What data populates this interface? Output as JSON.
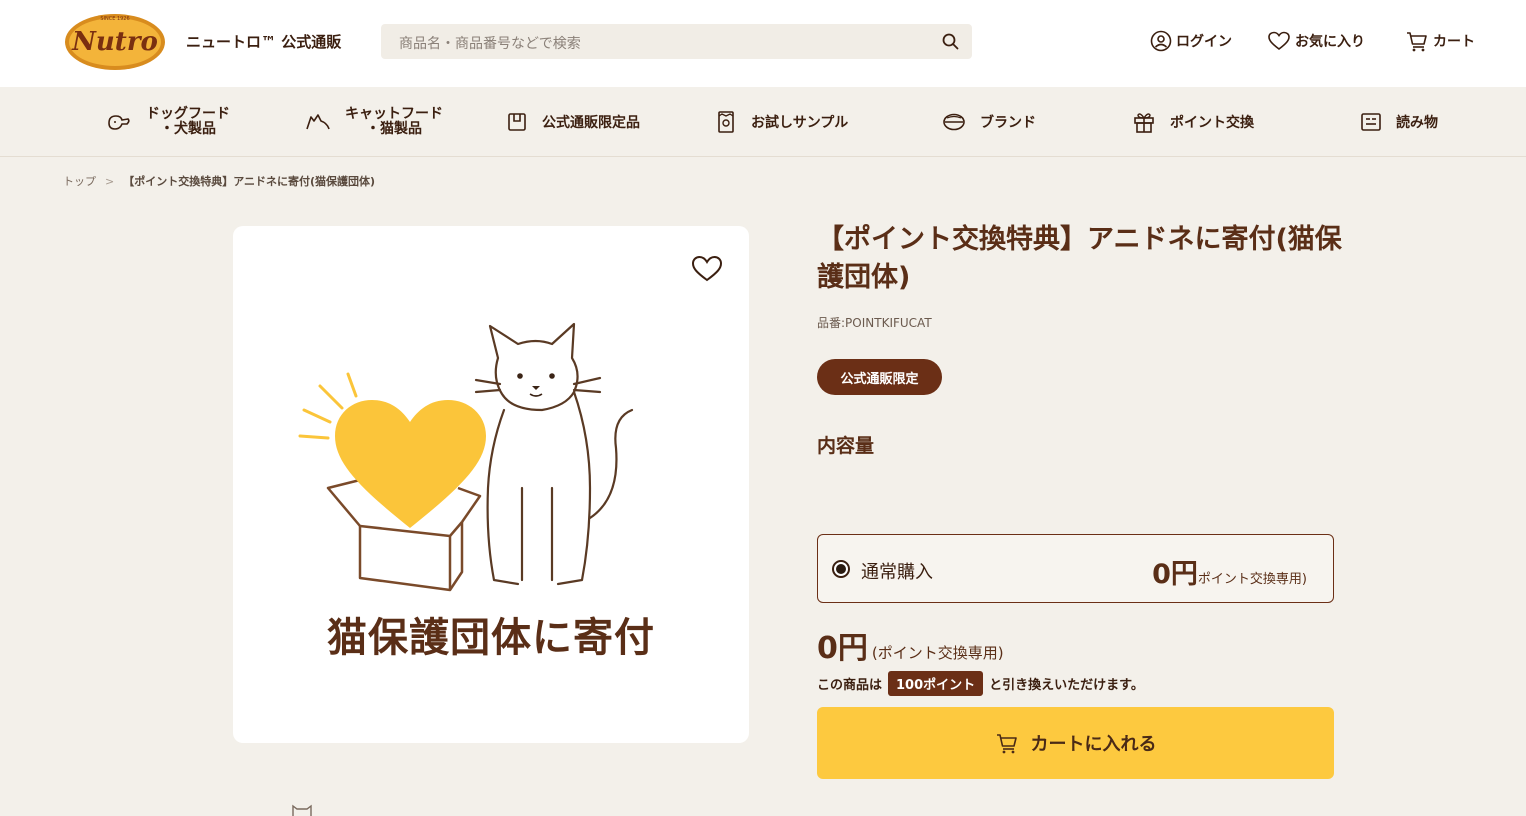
{
  "header": {
    "logo_alt": "Nutro",
    "brand": "ニュートロ™ 公式通販",
    "search_placeholder": "商品名・商品番号などで検索",
    "login": "ログイン",
    "favorites": "お気に入り",
    "cart": "カート"
  },
  "nav": {
    "items": [
      {
        "line1": "ドッグフード",
        "line2": "・犬製品",
        "icon": "dog-icon"
      },
      {
        "line1": "キャットフード",
        "line2": "・猫製品",
        "icon": "cat-icon"
      },
      {
        "line1": "公式通販限定品",
        "line2": "",
        "icon": "box-icon"
      },
      {
        "line1": "お試しサンプル",
        "line2": "",
        "icon": "sample-bag-icon"
      },
      {
        "line1": "ブランド",
        "line2": "",
        "icon": "brand-icon"
      },
      {
        "line1": "ポイント交換",
        "line2": "",
        "icon": "gift-icon"
      },
      {
        "line1": "読み物",
        "line2": "",
        "icon": "article-icon"
      }
    ]
  },
  "breadcrumb": {
    "home": "トップ",
    "separator": ">",
    "current": "【ポイント交換特典】アニドネに寄付(猫保護団体)"
  },
  "product": {
    "image_caption": "猫保護団体に寄付",
    "title": "【ポイント交換特典】アニドネに寄付(猫保護団体)",
    "sku": "品番:POINTKIFUCAT",
    "badge": "公式通販限定",
    "volume_label": "内容量",
    "purchase_option": "通常購入",
    "option_price": "0円",
    "option_price_note": "ポイント交換専用)",
    "price": "0円",
    "price_note": "(ポイント交換専用)",
    "points_prefix": "この商品は",
    "points_value": "100ポイント",
    "points_suffix": "と引き換えいただけます。",
    "cart_button": "カートに入れる"
  },
  "colors": {
    "background": "#f3f0ea",
    "brown": "#5a2e17",
    "badge": "#6b2f16",
    "cta": "#fdc93f",
    "heart": "#fbc53a"
  }
}
